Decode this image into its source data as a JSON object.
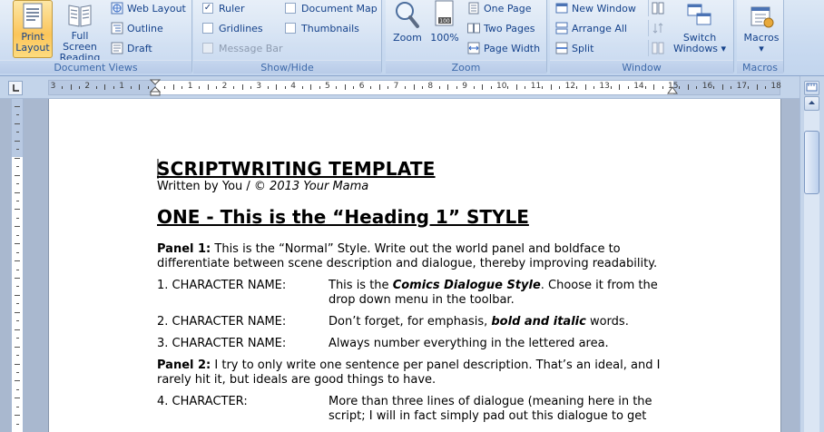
{
  "ribbon": {
    "document_views": {
      "title": "Document Views",
      "print_layout": {
        "line1": "Print",
        "line2": "Layout"
      },
      "full_screen_reading": {
        "line1": "Full Screen",
        "line2": "Reading"
      },
      "web_layout": "Web Layout",
      "outline": "Outline",
      "draft": "Draft"
    },
    "show_hide": {
      "title": "Show/Hide",
      "ruler": "Ruler",
      "gridlines": "Gridlines",
      "message_bar": "Message Bar",
      "document_map": "Document Map",
      "thumbnails": "Thumbnails",
      "ruler_checked": "✓"
    },
    "zoom": {
      "title": "Zoom",
      "zoom": "Zoom",
      "hundred": "100%",
      "one_page": "One Page",
      "two_pages": "Two Pages",
      "page_width": "Page Width"
    },
    "window": {
      "title": "Window",
      "new_window": "New Window",
      "arrange_all": "Arrange All",
      "split": "Split",
      "switch_windows": {
        "line1": "Switch",
        "line2": "Windows ▾"
      }
    },
    "macros": {
      "title": "Macros",
      "macros": {
        "line1": "Macros",
        "line2": "▾"
      }
    }
  },
  "ruler": {
    "labels": [
      "3",
      "2",
      "1",
      "1",
      "2",
      "3",
      "4",
      "5",
      "6",
      "7",
      "8",
      "9",
      "10",
      "11",
      "12",
      "13",
      "14",
      "15",
      "16",
      "17",
      "18"
    ]
  },
  "document": {
    "title": "SCRIPTWRITING TEMPLATE",
    "byline_plain": "Written by You / ",
    "byline_italic": "© 2013 Your Mama",
    "heading1": "ONE - This is the “Heading 1” STYLE",
    "panel1_label": "Panel 1:",
    "panel1_text": " This is the “Normal” Style. Write out the world panel and boldface to differentiate between scene description and dialogue, thereby improving readability.",
    "dialogue": [
      {
        "who": "1. CHARACTER  NAME:",
        "pre": "This is the ",
        "emph": "Comics Dialogue Style",
        "post": ". Choose it from the drop down menu in the toolbar."
      },
      {
        "who": "2. CHARACTER  NAME:",
        "pre": "Don’t forget, for emphasis, ",
        "emph": "bold and italic",
        "post": " words."
      },
      {
        "who": "3. CHARACTER  NAME:",
        "pre": "Always number everything in the lettered area.",
        "emph": "",
        "post": ""
      }
    ],
    "panel2_label": "Panel 2:",
    "panel2_text": " I try to only write one sentence per panel description. That’s an ideal, and I rarely hit it, but ideals are good things to have.",
    "dialogue4_who": "4. CHARACTER:",
    "dialogue4_text": "More than three lines of dialogue (meaning here in the script; I will in fact simply pad out this dialogue to get"
  },
  "colors": {
    "ribbon_text": "#15428b",
    "active_button": "#fbc55a",
    "workspace": "#a9b8cf"
  }
}
